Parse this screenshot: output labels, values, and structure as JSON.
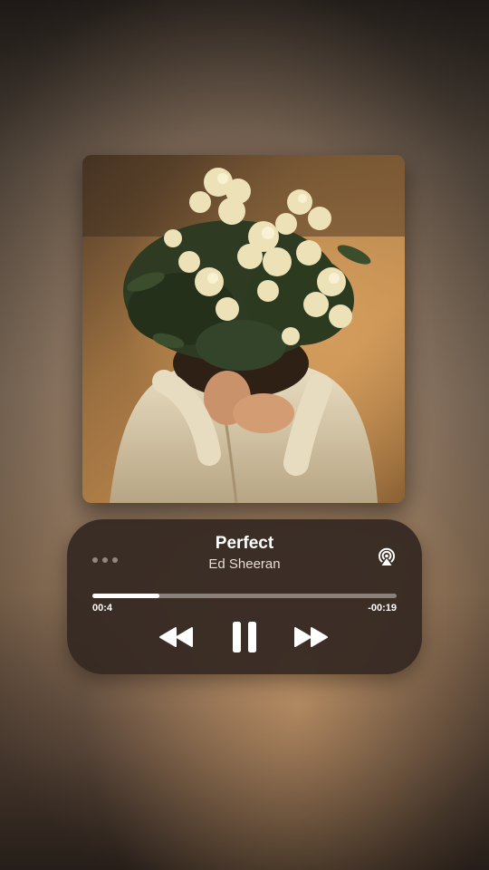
{
  "now_playing": {
    "title": "Perfect",
    "artist": "Ed Sheeran",
    "elapsed": "00:4",
    "remaining": "-00:19",
    "progress_fraction": 0.22
  },
  "icons": {
    "more": "more-dots-icon",
    "airplay": "airplay-icon",
    "rewind": "rewind-icon",
    "pause": "pause-icon",
    "forward": "fast-forward-icon"
  },
  "colors": {
    "card_background": "#342821",
    "progress_fill": "#ffffff",
    "progress_track": "#8a817a",
    "text_primary": "#ffffff"
  }
}
